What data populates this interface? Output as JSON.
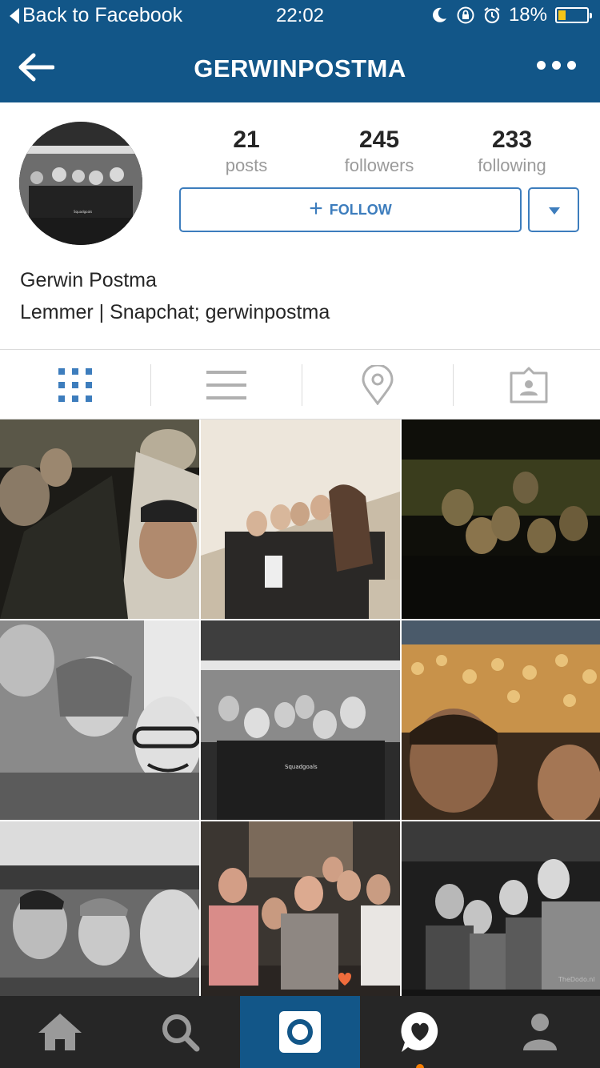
{
  "status_bar": {
    "back_label": "Back to Facebook",
    "time": "22:02",
    "battery": "18%",
    "battery_level": 0.18
  },
  "nav": {
    "title": "GERWINPOSTMA",
    "back_icon": "back-arrow-icon",
    "more_icon": "more-dots-icon"
  },
  "profile": {
    "stats": [
      {
        "value": "21",
        "label": "posts"
      },
      {
        "value": "245",
        "label": "followers"
      },
      {
        "value": "233",
        "label": "following"
      }
    ],
    "follow_label": "FOLLOW",
    "name": "Gerwin Postma",
    "bio": "Lemmer | Snapchat; gerwinpostma",
    "avatar_caption": "Squadgoals"
  },
  "tabs": [
    {
      "icon": "grid-icon",
      "active": true
    },
    {
      "icon": "list-icon",
      "active": false
    },
    {
      "icon": "location-pin-icon",
      "active": false
    },
    {
      "icon": "tagged-photos-icon",
      "active": false
    }
  ],
  "photos": [
    {
      "caption": ""
    },
    {
      "caption": ""
    },
    {
      "caption": ""
    },
    {
      "caption": ""
    },
    {
      "caption": "Squadgoals"
    },
    {
      "caption": ""
    },
    {
      "caption": ""
    },
    {
      "caption": ""
    },
    {
      "caption": "TheDodo.nl"
    }
  ],
  "bottom_nav": [
    {
      "icon": "home-icon"
    },
    {
      "icon": "search-icon"
    },
    {
      "icon": "camera-icon"
    },
    {
      "icon": "activity-heart-icon"
    },
    {
      "icon": "profile-icon"
    }
  ],
  "colors": {
    "brand": "#125688",
    "accent": "#3d7dbd",
    "bottom_bar": "#262626",
    "notification": "#f57c00"
  }
}
